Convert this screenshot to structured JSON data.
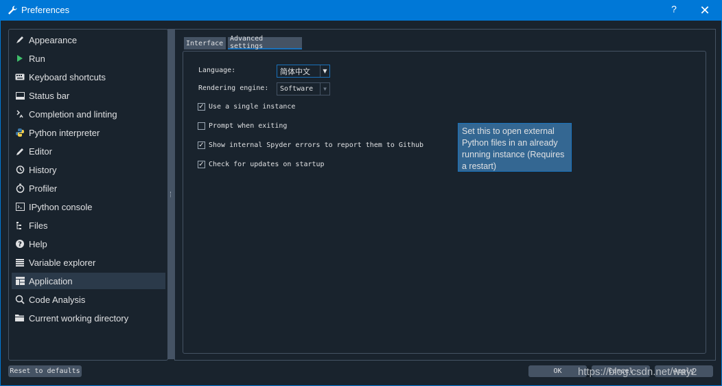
{
  "window": {
    "title": "Preferences",
    "help_label": "?",
    "close_label": "✕",
    "icon": "wrench-icon"
  },
  "sidebar": {
    "items": [
      {
        "label": "Appearance",
        "icon": "pen-brush-icon"
      },
      {
        "label": "Run",
        "icon": "play-icon"
      },
      {
        "label": "Keyboard shortcuts",
        "icon": "keyboard-icon"
      },
      {
        "label": "Status bar",
        "icon": "status-bar-icon"
      },
      {
        "label": "Completion and linting",
        "icon": "completion-icon"
      },
      {
        "label": "Python interpreter",
        "icon": "python-icon"
      },
      {
        "label": "Editor",
        "icon": "pencil-icon"
      },
      {
        "label": "History",
        "icon": "history-icon"
      },
      {
        "label": "Profiler",
        "icon": "stopwatch-icon"
      },
      {
        "label": "IPython console",
        "icon": "console-icon"
      },
      {
        "label": "Files",
        "icon": "files-icon"
      },
      {
        "label": "Help",
        "icon": "help-icon"
      },
      {
        "label": "Variable explorer",
        "icon": "table-icon"
      },
      {
        "label": "Application",
        "icon": "application-icon",
        "selected": true
      },
      {
        "label": "Code Analysis",
        "icon": "code-analysis-icon"
      },
      {
        "label": "Current working directory",
        "icon": "folder-icon"
      }
    ]
  },
  "tabs": [
    {
      "label": "Interface",
      "active": false
    },
    {
      "label": "Advanced settings",
      "active": true
    }
  ],
  "advanced": {
    "language_label": "Language:",
    "language_value": "简体中文",
    "rendering_label": "Rendering engine:",
    "rendering_value": "Software",
    "checkboxes": [
      {
        "label": "Use a single instance",
        "checked": true,
        "mark": "✓"
      },
      {
        "label": "Prompt when exiting",
        "checked": false,
        "mark": ""
      },
      {
        "label": "Show internal Spyder errors to report them to Github",
        "checked": true,
        "mark": "✓"
      },
      {
        "label": "Check for updates on startup",
        "checked": true,
        "mark": "✓"
      }
    ]
  },
  "tooltip": {
    "text": "Set this to open external Python files in an already running instance (Requires a restart)"
  },
  "footer": {
    "reset_label": "Reset to defaults",
    "ok_label": "OK",
    "cancel_label": "Cancel",
    "apply_label": "Apply",
    "watermark": "https://blog.csdn.net/way2"
  },
  "colors": {
    "titlebar": "#0078d7",
    "background": "#19232d",
    "selection": "#2b3a4a",
    "accent": "#1a72bb",
    "tooltip_bg": "#346792",
    "button_bg": "#455364"
  }
}
